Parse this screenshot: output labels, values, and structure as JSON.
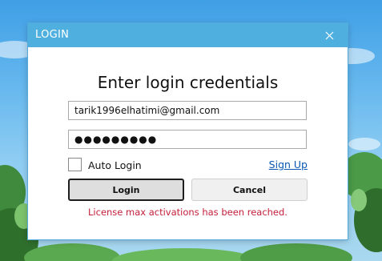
{
  "dialog": {
    "title": "LOGIN",
    "heading": "Enter login credentials",
    "email_value": "tarik1996elhatimi@gmail.com",
    "password_value": "●●●●●●●●●",
    "auto_login_label": "Auto Login",
    "auto_login_checked": false,
    "signup_label": "Sign Up",
    "login_label": "Login",
    "cancel_label": "Cancel",
    "error_message": "License max activations has been reached."
  },
  "icons": {
    "close": "close-icon"
  },
  "colors": {
    "titlebar": "#4fb0e0",
    "error": "#c41e3a",
    "link": "#0a58b3"
  }
}
